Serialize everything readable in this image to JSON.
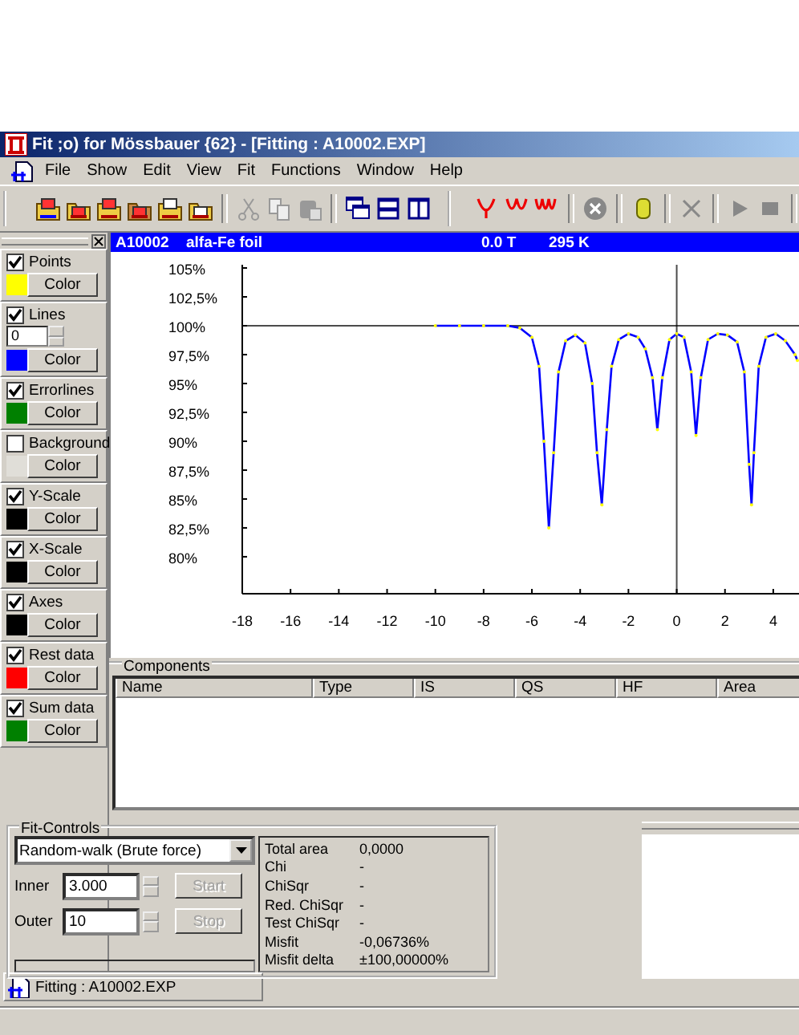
{
  "window": {
    "title": "Fit ;o) for Mössbauer {62} - [Fitting : A10002.EXP]"
  },
  "menu": [
    "File",
    "Show",
    "Edit",
    "View",
    "Fit",
    "Functions",
    "Window",
    "Help"
  ],
  "side_panel": {
    "options": [
      {
        "kind": "color",
        "label": "Points",
        "checked": true,
        "color": "#ffff00",
        "button": "Color"
      },
      {
        "kind": "spinner",
        "label": "Lines",
        "checked": true,
        "color": "#0000ff",
        "button": "Color",
        "value": "0"
      },
      {
        "kind": "color",
        "label": "Errorlines",
        "checked": true,
        "color": "#008000",
        "button": "Color"
      },
      {
        "kind": "color",
        "label": "Background",
        "checked": false,
        "color": "#e0ded8",
        "button": "Color"
      },
      {
        "kind": "color",
        "label": "Y-Scale",
        "checked": true,
        "color": "#000000",
        "button": "Color"
      },
      {
        "kind": "color",
        "label": "X-Scale",
        "checked": true,
        "color": "#000000",
        "button": "Color"
      },
      {
        "kind": "color",
        "label": "Axes",
        "checked": true,
        "color": "#000000",
        "button": "Color"
      },
      {
        "kind": "color",
        "label": "Rest data",
        "checked": true,
        "color": "#ff0000",
        "button": "Color"
      },
      {
        "kind": "color",
        "label": "Sum data",
        "checked": true,
        "color": "#008000",
        "button": "Color"
      }
    ]
  },
  "spectrum": {
    "header": {
      "id": "A10002",
      "sample": "alfa-Fe foil",
      "field": "0.0 T",
      "temperature": "295 K"
    },
    "chart_data": {
      "type": "line",
      "x": [
        -10,
        -9,
        -8,
        -7,
        -6.5,
        -6,
        -5.7,
        -5.5,
        -5.3,
        -5.1,
        -4.9,
        -4.6,
        -4.2,
        -3.8,
        -3.5,
        -3.3,
        -3.1,
        -2.9,
        -2.7,
        -2.4,
        -2,
        -1.6,
        -1.3,
        -1.0,
        -0.8,
        -0.6,
        -0.3,
        0,
        0.3,
        0.6,
        0.8,
        1.0,
        1.3,
        1.7,
        2.1,
        2.5,
        2.8,
        3.0,
        3.1,
        3.2,
        3.4,
        3.7,
        4.1,
        4.5,
        4.9,
        5.0
      ],
      "series": [
        {
          "color": "#0000ff",
          "values": [
            100,
            100,
            100,
            100,
            99.8,
            99.0,
            96.5,
            90,
            82.5,
            89,
            96,
            98.7,
            99.2,
            98.5,
            95,
            89,
            84.5,
            91,
            96.5,
            98.8,
            99.3,
            99,
            98,
            95.5,
            91,
            95.5,
            98.8,
            99.3,
            99,
            96,
            90.5,
            95.5,
            98.8,
            99.3,
            99.2,
            98.6,
            96,
            88,
            84.5,
            89,
            96.5,
            99,
            99.3,
            98.7,
            97.5,
            97
          ]
        }
      ],
      "xlim": [
        -18,
        5
      ],
      "ylim": [
        76.8,
        105
      ],
      "xticks": [
        -18,
        -16,
        -14,
        -12,
        -10,
        -8,
        -6,
        -4,
        -2,
        0,
        2,
        4
      ],
      "yticks": [
        {
          "value": 105,
          "label": "105%"
        },
        {
          "value": 102.5,
          "label": "102,5%"
        },
        {
          "value": 100,
          "label": "100%"
        },
        {
          "value": 97.5,
          "label": "97,5%"
        },
        {
          "value": 95,
          "label": "95%"
        },
        {
          "value": 92.5,
          "label": "92,5%"
        },
        {
          "value": 90,
          "label": "90%"
        },
        {
          "value": 87.5,
          "label": "87,5%"
        },
        {
          "value": 85,
          "label": "85%"
        },
        {
          "value": 82.5,
          "label": "82,5%"
        },
        {
          "value": 80,
          "label": "80%"
        }
      ]
    }
  },
  "components": {
    "title": "Components",
    "columns": [
      "Name",
      "Type",
      "IS",
      "QS",
      "HF",
      "Area"
    ]
  },
  "fit_controls": {
    "title": "Fit-Controls",
    "method": "Random-walk (Brute force)",
    "inner_label": "Inner",
    "inner": "3.000",
    "outer_label": "Outer",
    "outer": "10",
    "buttons": [
      {
        "label": "Start",
        "disabled": true
      },
      {
        "label": "Stop",
        "disabled": true
      }
    ],
    "progress": {
      "level": 0
    },
    "stats": [
      {
        "label": "Total area",
        "value": "0,0000"
      },
      {
        "label": "Chi",
        "value": "-"
      },
      {
        "label": "ChiSqr",
        "value": "-"
      },
      {
        "label": "Red. ChiSqr",
        "value": "-"
      },
      {
        "label": "Test ChiSqr",
        "value": "-"
      },
      {
        "label": "Misfit",
        "value": "-0,06736%"
      },
      {
        "label": "Misfit delta",
        "value": "±100,00000%"
      }
    ]
  },
  "task": {
    "label": "Fitting : A10002.EXP"
  }
}
